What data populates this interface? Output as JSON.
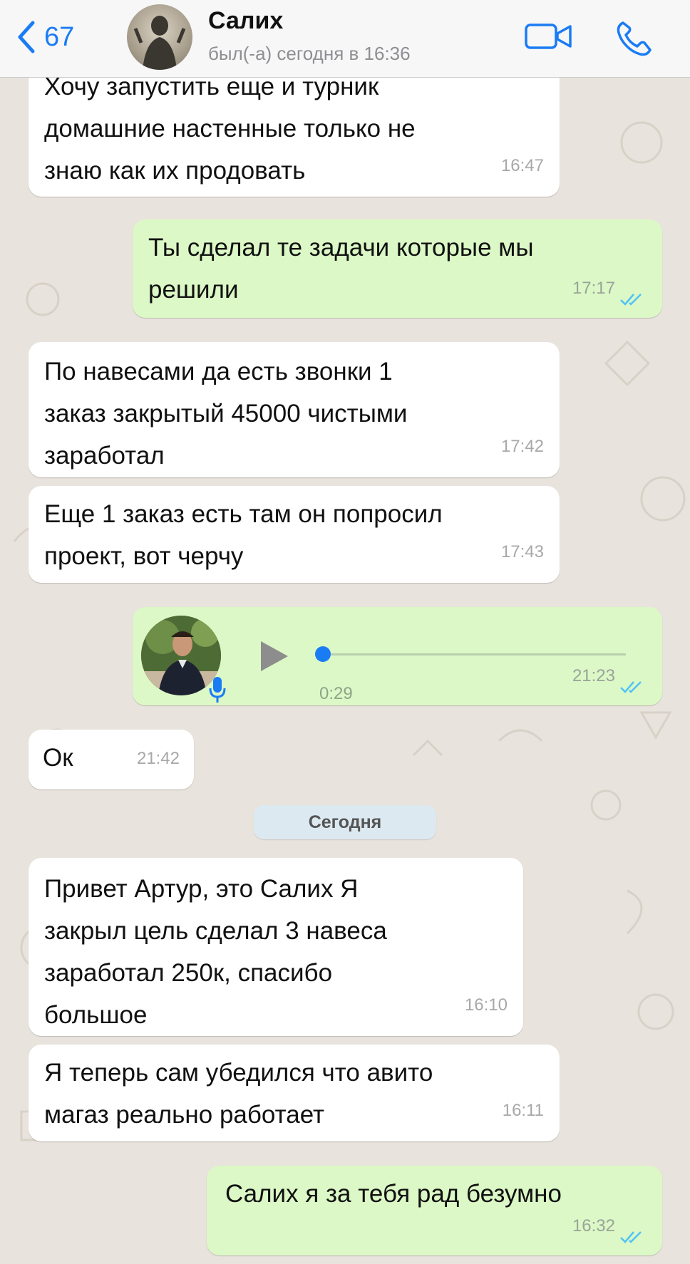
{
  "header": {
    "back_count": "67",
    "contact_name": "Салих",
    "contact_status": "был(-а) сегодня в 16:36"
  },
  "messages": [
    {
      "direction": "in",
      "text": "Хочу запустить еще и турник\nдомашние настенные только не\nзнаю как их продовать",
      "time": "16:47"
    },
    {
      "direction": "out",
      "text": "Ты сделал те задачи которые мы\nрешили",
      "time": "17:17",
      "read": true
    },
    {
      "direction": "in",
      "text": "По навесами да есть звонки 1\nзаказ закрытый 45000 чистыми\nзаработал",
      "time": "17:42"
    },
    {
      "direction": "in",
      "text": "Еще 1 заказ есть там он попросил\nпроект, вот черчу",
      "time": "17:43"
    },
    {
      "direction": "out",
      "type": "voice",
      "duration": "0:29",
      "time": "21:23",
      "read": true,
      "progress": 0.0
    },
    {
      "direction": "in",
      "text": "Ок",
      "time": "21:42"
    },
    {
      "direction": "in",
      "text": "Привет Артур, это Салих Я\nзакрыл цель сделал 3 навеса\nзаработал 250к, спасибо\nбольшое",
      "time": "16:10"
    },
    {
      "direction": "in",
      "text": "Я теперь сам убедился что авито\nмагаз реально работает",
      "time": "16:11"
    },
    {
      "direction": "out",
      "text": "Салих я за тебя рад безумно",
      "time": "16:32",
      "read": true
    }
  ],
  "date_divider": "Сегодня",
  "colors": {
    "accent": "#1a7cf5",
    "outgoing_bubble": "#dcf8c6",
    "incoming_bubble": "#ffffff",
    "read_ticks": "#4fc3f7",
    "background": "#e8e3dc"
  },
  "icons": [
    "chevron-left-icon",
    "video-call-icon",
    "phone-icon",
    "play-icon",
    "microphone-icon",
    "double-check-icon"
  ]
}
